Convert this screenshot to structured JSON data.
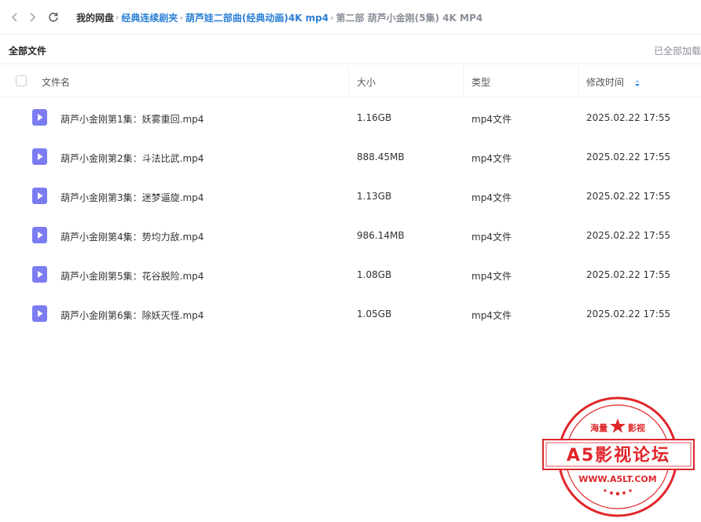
{
  "breadcrumb": [
    {
      "label": "我的网盘",
      "kind": "root"
    },
    {
      "label": "经典连续剧夹",
      "kind": "link"
    },
    {
      "label": "葫芦娃二部曲(经典动画)4K mp4",
      "kind": "link"
    },
    {
      "label": "第二部 葫芦小金刚(5集) 4K MP4",
      "kind": "current"
    }
  ],
  "toolbar": {
    "all_files_label": "全部文件",
    "loaded_all_label": "已全部加载"
  },
  "table": {
    "columns": {
      "name": "文件名",
      "size": "大小",
      "type": "类型",
      "modified": "修改时间"
    },
    "rows": [
      {
        "name": "葫芦小金刚第1集：妖雾重回.mp4",
        "size": "1.16GB",
        "type": "mp4文件",
        "modified": "2025.02.22 17:55"
      },
      {
        "name": "葫芦小金刚第2集：斗法比武.mp4",
        "size": "888.45MB",
        "type": "mp4文件",
        "modified": "2025.02.22 17:55"
      },
      {
        "name": "葫芦小金刚第3集：迷梦逼旋.mp4",
        "size": "1.13GB",
        "type": "mp4文件",
        "modified": "2025.02.22 17:55"
      },
      {
        "name": "葫芦小金刚第4集：势均力敌.mp4",
        "size": "986.14MB",
        "type": "mp4文件",
        "modified": "2025.02.22 17:55"
      },
      {
        "name": "葫芦小金刚第5集：花谷脱险.mp4",
        "size": "1.08GB",
        "type": "mp4文件",
        "modified": "2025.02.22 17:55"
      },
      {
        "name": "葫芦小金刚第6集：除妖灭怪.mp4",
        "size": "1.05GB",
        "type": "mp4文件",
        "modified": "2025.02.22 17:55"
      }
    ]
  },
  "watermark": {
    "top_text": "海量 影视",
    "main_text": "A5影视论坛",
    "url_text": "WWW.A5LT.COM"
  },
  "colors": {
    "link": "#2b7fd6",
    "muted": "#8a8f99",
    "file_icon": "#7b7cf2",
    "sort_icon": "#3d8bf2",
    "stamp": "#e0262b"
  },
  "icons": {
    "back": "chevron-left-icon",
    "forward": "chevron-right-icon",
    "refresh": "refresh-icon",
    "file": "video-file-icon",
    "sort": "sort-icon"
  }
}
